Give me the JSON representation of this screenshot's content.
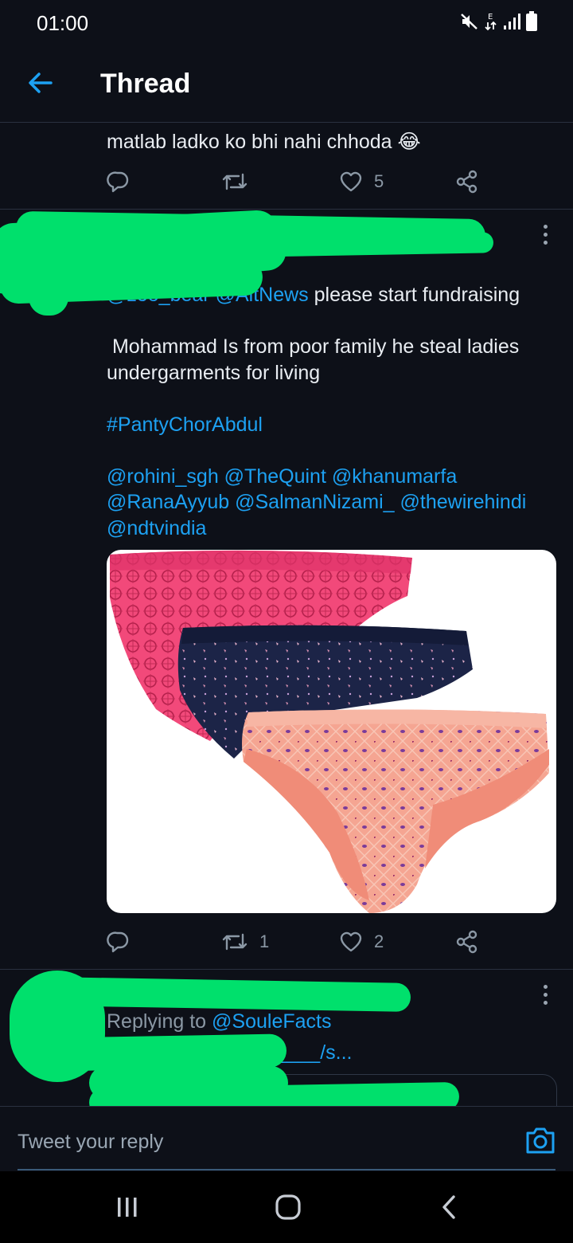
{
  "status_bar": {
    "time": "01:00"
  },
  "header": {
    "title": "Thread"
  },
  "previous_tweet": {
    "text_line": "matlab ladko ko bhi nahi chhoda",
    "emoji": "😂",
    "like_count": "5"
  },
  "main_tweet": {
    "mentions_line": [
      "@zoo_bear",
      "@AltNews"
    ],
    "line1_rest": " please start fundraising",
    "paragraph2": " Mohammad Is from poor family he steal ladies undergarments for living",
    "hashtag": "#PantyChorAbdul",
    "tagged_line1": "@rohini_sgh @TheQuint @khanumarfa",
    "tagged_line2": "@RanaAyyub @SalmanNizami_ @thewirehindi",
    "tagged_line3": "@ndtvindia",
    "retweet_count": "1",
    "like_count": "2"
  },
  "reply_tweet": {
    "replying_prefix": "Replying to ",
    "replying_handle": "@SouleFacts",
    "link_text": "twitter.com/ayushi_____/s..."
  },
  "composer": {
    "placeholder": "Tweet your reply"
  },
  "colors": {
    "accent": "#1da1f2",
    "background": "#0d1018",
    "redaction": "#00e06c"
  },
  "icons": [
    "back-arrow-icon",
    "reply-icon",
    "retweet-icon",
    "like-icon",
    "share-icon",
    "more-icon",
    "camera-icon",
    "recent-apps-icon",
    "home-icon",
    "back-nav-icon",
    "mute-icon",
    "data-icon",
    "signal-icon",
    "battery-icon"
  ]
}
